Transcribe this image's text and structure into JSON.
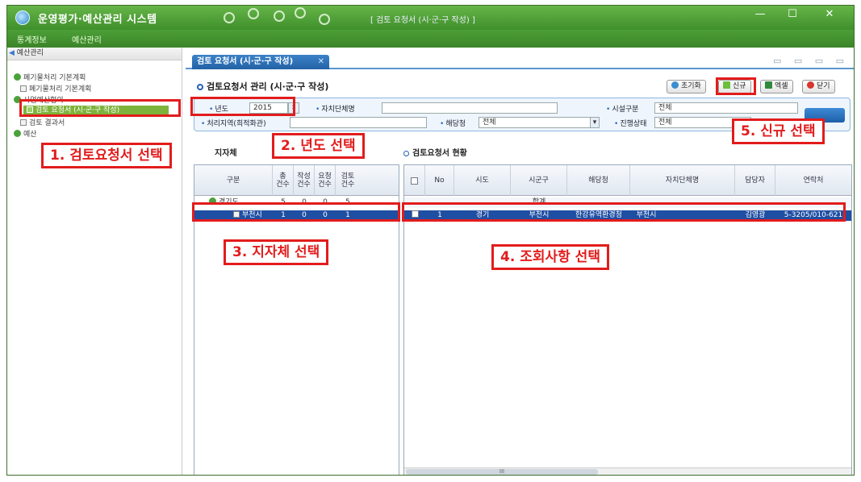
{
  "window": {
    "app_title": "운영평가·예산관리 시스템",
    "subtitle": "[ 검토 요청서 (시·군·구 작성) ]",
    "controls": {
      "minimize": "—",
      "maximize": "☐",
      "close": "✕"
    }
  },
  "menu": {
    "items": [
      "통계정보",
      "예산관리"
    ]
  },
  "sidebar": {
    "header": "예산관리",
    "tree": [
      {
        "label": "폐기물처리 기본계획",
        "level": 0
      },
      {
        "label": "폐기물처리 기본계획",
        "level": 1
      },
      {
        "label": "사업예산협의",
        "level": 0
      },
      {
        "label": "검토 요청서 (시·군·구 작성)",
        "level": 1,
        "selected": true
      },
      {
        "label": "검토 결과서",
        "level": 1
      },
      {
        "label": "예산",
        "level": 0
      }
    ]
  },
  "tab": {
    "label": "검토 요청서 (시·군·구 작성)",
    "close": "✕",
    "tools": "▭ ▭ ▭ ▭"
  },
  "section_title": "검토요청서 관리 (시·군·구 작성)",
  "buttons": {
    "reset": "초기화",
    "new": "신규",
    "excel": "엑셀",
    "close": "닫기"
  },
  "search": {
    "year_label": "년도",
    "year_value": "2015",
    "local_gov_label": "자치단체명",
    "facility_label": "시설구분",
    "facility_value": "전체",
    "region_label": "처리지역(희적화관)",
    "agency_label": "해당청",
    "agency_value": "전체",
    "progress_label": "진행상태",
    "progress_value": "전체"
  },
  "left_panel": {
    "title": "지자체",
    "headers": [
      "구분",
      "총\n건수",
      "작성\n건수",
      "요청\n건수",
      "검토\n건수"
    ],
    "rows": [
      {
        "name": "경기도",
        "cols": [
          "5",
          "0",
          "0",
          "5"
        ]
      },
      {
        "name": "부천시",
        "cols": [
          "1",
          "0",
          "0",
          "1"
        ]
      }
    ]
  },
  "right_panel": {
    "title": "검토요청서 현황",
    "headers": [
      "No",
      "시도",
      "시군구",
      "해당청",
      "자치단체명",
      "담당자",
      "연락처"
    ],
    "total_label": "합계",
    "rows": [
      {
        "no": "1",
        "sido": "경기",
        "sigungu": "부천시",
        "agency": "한강유역환경청",
        "local_gov": "부천시",
        "manager": "김영광",
        "contact": "5-3205/010-621"
      }
    ],
    "scroll_label": "III"
  },
  "annotations": {
    "step1": "1. 검토요청서 선택",
    "step2": "2. 년도 선택",
    "step3": "3. 지자체 선택",
    "step4": "4. 조회사항 선택",
    "step5": "5. 신규 선택"
  },
  "colors": {
    "titlebar": "#4a9f35",
    "accent": "#2462a6",
    "annotation": "#e21c1c",
    "selected_row": "#1f4fa3"
  }
}
